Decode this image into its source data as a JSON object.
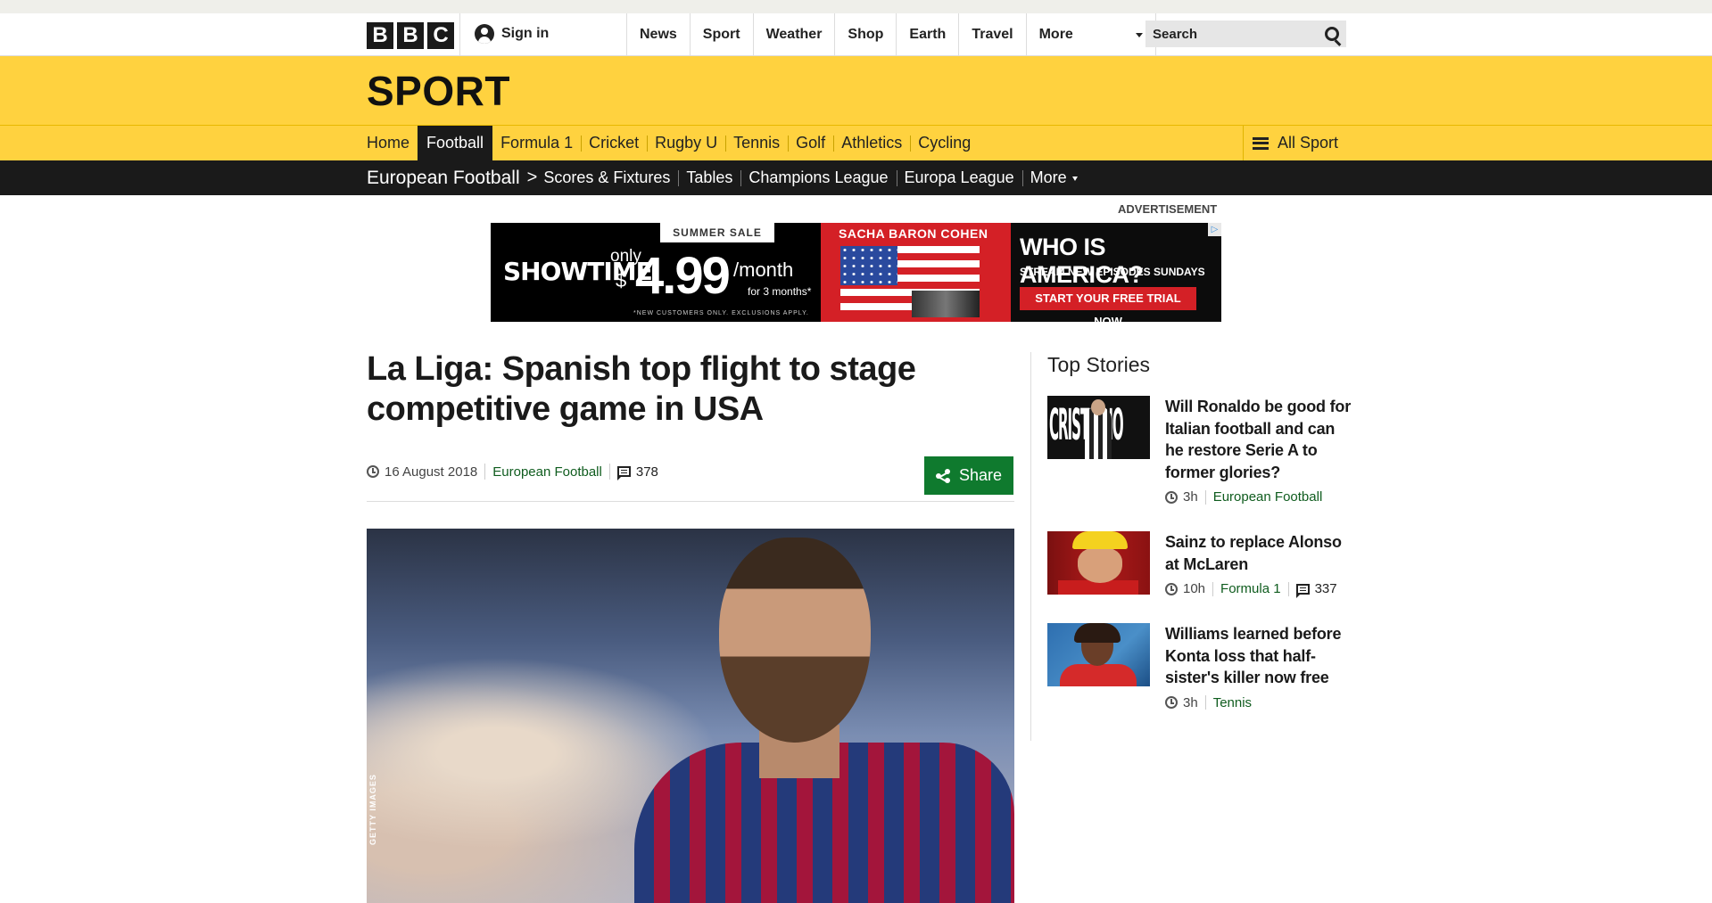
{
  "global_nav": {
    "logo_letters": [
      "B",
      "B",
      "C"
    ],
    "sign_in": "Sign in",
    "links": [
      "News",
      "Sport",
      "Weather",
      "Shop",
      "Earth",
      "Travel"
    ],
    "more": "More",
    "search_placeholder": "Search"
  },
  "sport": {
    "title": "SPORT",
    "nav": [
      "Home",
      "Football",
      "Formula 1",
      "Cricket",
      "Rugby U",
      "Tennis",
      "Golf",
      "Athletics",
      "Cycling"
    ],
    "active": "Football",
    "all_sport": "All Sport",
    "accent_color": "#ffd23f"
  },
  "sub_nav": {
    "section": "European Football",
    "chevron": ">",
    "links": [
      "Scores & Fixtures",
      "Tables",
      "Champions League",
      "Europa League"
    ],
    "more": "More"
  },
  "advert": {
    "label": "ADVERTISEMENT",
    "sale": "SUMMER SALE",
    "brand": "SHOWTIME",
    "only": "only",
    "dollar": "$",
    "price": "4.99",
    "per": "/month",
    "duration": "for 3 months*",
    "fine_print": "*NEW CUSTOMERS ONLY. EXCLUSIONS APPLY.",
    "star": "SACHA BARON COHEN",
    "show": "WHO IS AMERICA?",
    "stream": "STREAM NEW EPISODES SUNDAYS",
    "cta": "START YOUR FREE TRIAL NOW",
    "adchoices": "▷"
  },
  "article": {
    "headline": "La Liga: Spanish top flight to stage competitive game in USA",
    "date": "16 August 2018",
    "category": "European Football",
    "comments": "378",
    "share": "Share",
    "image_credit": "GETTY IMAGES"
  },
  "top_stories": {
    "title": "Top Stories",
    "items": [
      {
        "headline": "Will Ronaldo be good for Italian football and can he restore Serie A to former glories?",
        "time": "3h",
        "category": "European Football",
        "comments": "",
        "thumb_text": "CRISTIANO"
      },
      {
        "headline": "Sainz to replace Alonso at McLaren",
        "time": "10h",
        "category": "Formula 1",
        "comments": "337",
        "thumb_text": ""
      },
      {
        "headline": "Williams learned before Konta loss that half-sister's killer now free",
        "time": "3h",
        "category": "Tennis",
        "comments": "",
        "thumb_text": ""
      }
    ]
  }
}
